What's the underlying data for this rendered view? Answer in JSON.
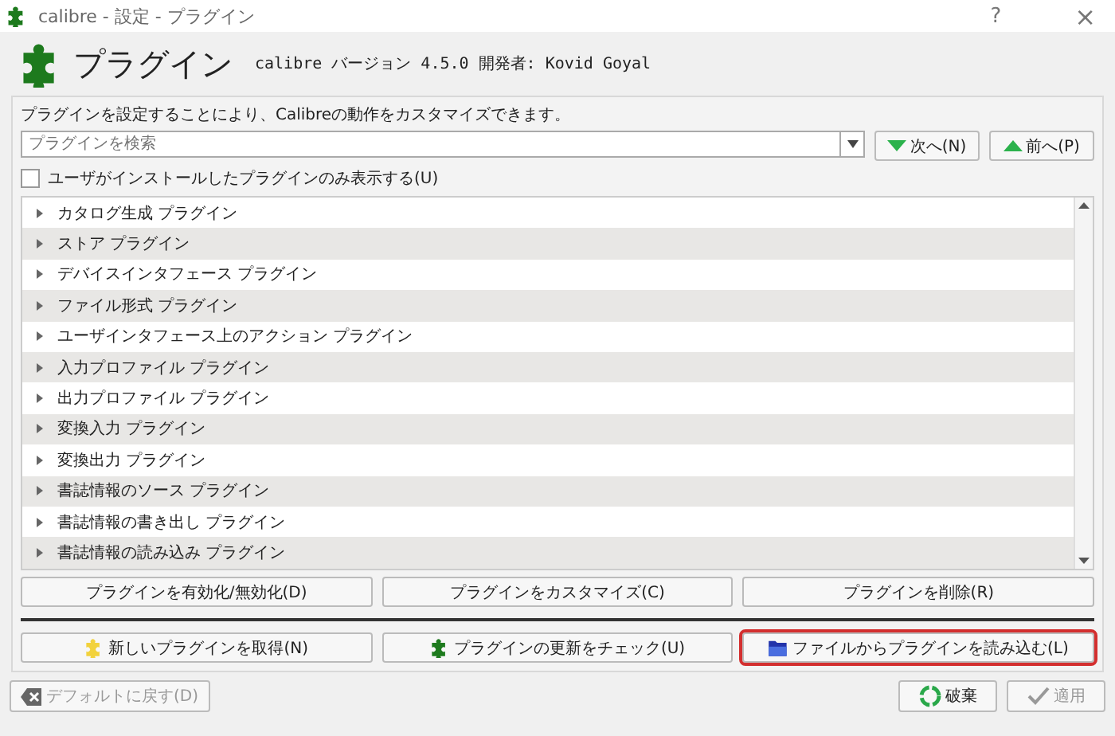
{
  "window": {
    "title": "calibre - 設定 - プラグイン",
    "help": "?",
    "close": "×"
  },
  "header": {
    "title": "プラグイン",
    "subtitle": "calibre バージョン 4.5.0 開発者: Kovid Goyal"
  },
  "description": "プラグインを設定することにより、Calibreの動作をカスタマイズできます。",
  "search": {
    "placeholder": "プラグインを検索"
  },
  "nav_buttons": [
    {
      "kind": "down",
      "label": "次へ(N)"
    },
    {
      "kind": "up",
      "label": "前へ(P)"
    }
  ],
  "user_only": {
    "label": "ユーザがインストールしたプラグインのみ表示する(U)",
    "checked": false
  },
  "tree": [
    {
      "label": "カタログ生成 プラグイン",
      "expanded": false
    },
    {
      "label": "ストア プラグイン",
      "expanded": false
    },
    {
      "label": "デバイスインタフェース プラグイン",
      "expanded": false
    },
    {
      "label": "ファイル形式 プラグイン",
      "expanded": false
    },
    {
      "label": "ユーザインタフェース上のアクション プラグイン",
      "expanded": false
    },
    {
      "label": "入力プロファイル プラグイン",
      "expanded": false
    },
    {
      "label": "出力プロファイル プラグイン",
      "expanded": false
    },
    {
      "label": "変換入力 プラグイン",
      "expanded": false
    },
    {
      "label": "変換出力 プラグイン",
      "expanded": false
    },
    {
      "label": "書誌情報のソース プラグイン",
      "expanded": false
    },
    {
      "label": "書誌情報の書き出し プラグイン",
      "expanded": false
    },
    {
      "label": "書誌情報の読み込み プラグイン",
      "expanded": false
    }
  ],
  "action_buttons": [
    {
      "label": "プラグインを有効化/無効化(D)"
    },
    {
      "label": "プラグインをカスタマイズ(C)"
    },
    {
      "label": "プラグインを削除(R)"
    }
  ],
  "plugin_buttons": [
    {
      "kind": "new",
      "label": "新しいプラグインを取得(N)",
      "highlighted": false
    },
    {
      "kind": "update",
      "label": "プラグインの更新をチェック(U)",
      "highlighted": false
    },
    {
      "kind": "file",
      "label": "ファイルからプラグインを読み込む(L)",
      "highlighted": true
    }
  ],
  "footer": {
    "restore": {
      "label": "デフォルトに戻す(D)",
      "disabled": true
    },
    "discard": {
      "label": "破棄",
      "disabled": false
    },
    "apply": {
      "label": "適用",
      "disabled": true
    }
  }
}
